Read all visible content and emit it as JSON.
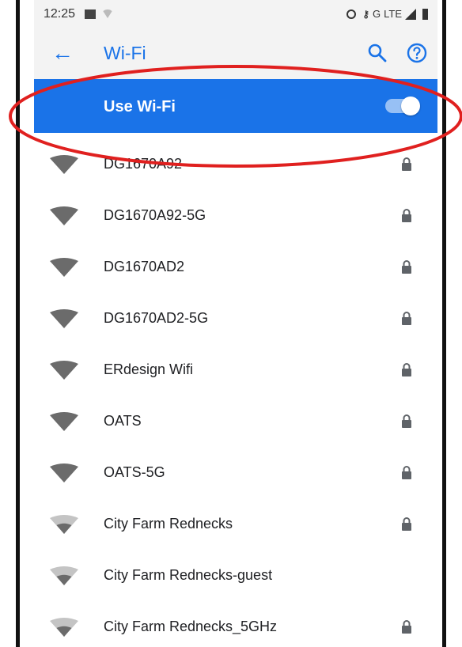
{
  "status_bar": {
    "time": "12:25",
    "network_label": "LTE",
    "key_label": "G"
  },
  "app_bar": {
    "title": "Wi-Fi"
  },
  "toggle": {
    "label": "Use Wi-Fi",
    "enabled": true
  },
  "colors": {
    "accent": "#1a73e8",
    "annotation": "#e0201f",
    "strong_signal": "#6b6b6b",
    "weak_signal": "#c4c4c4"
  },
  "networks": [
    {
      "name": "DG1670A92",
      "signal": "strong",
      "secured": true
    },
    {
      "name": "DG1670A92-5G",
      "signal": "strong",
      "secured": true
    },
    {
      "name": "DG1670AD2",
      "signal": "strong",
      "secured": true
    },
    {
      "name": "DG1670AD2-5G",
      "signal": "strong",
      "secured": true
    },
    {
      "name": "ERdesign Wifi",
      "signal": "strong",
      "secured": true
    },
    {
      "name": "OATS",
      "signal": "strong",
      "secured": true
    },
    {
      "name": "OATS-5G",
      "signal": "strong",
      "secured": true
    },
    {
      "name": "City Farm Rednecks",
      "signal": "medium",
      "secured": true
    },
    {
      "name": "City Farm Rednecks-guest",
      "signal": "medium",
      "secured": false
    },
    {
      "name": "City Farm Rednecks_5GHz",
      "signal": "medium",
      "secured": true
    }
  ]
}
